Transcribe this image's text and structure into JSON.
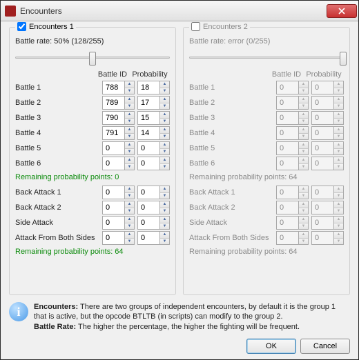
{
  "window": {
    "title": "Encounters"
  },
  "groups": [
    {
      "checked": true,
      "title": "Encounters 1",
      "rate_text": "Battle rate: 50% (128/255)",
      "slider_pos_pct": 50,
      "col_id": "Battle ID",
      "col_prob": "Probability",
      "battles": [
        {
          "label": "Battle 1",
          "id": "788",
          "prob": "18"
        },
        {
          "label": "Battle 2",
          "id": "789",
          "prob": "17"
        },
        {
          "label": "Battle 3",
          "id": "790",
          "prob": "15"
        },
        {
          "label": "Battle 4",
          "id": "791",
          "prob": "14"
        },
        {
          "label": "Battle 5",
          "id": "0",
          "prob": "0"
        },
        {
          "label": "Battle 6",
          "id": "0",
          "prob": "0"
        }
      ],
      "points1": "Remaining probability points: 0",
      "specials": [
        {
          "label": "Back Attack 1",
          "id": "0",
          "prob": "0"
        },
        {
          "label": "Back Attack 2",
          "id": "0",
          "prob": "0"
        },
        {
          "label": "Side Attack",
          "id": "0",
          "prob": "0"
        },
        {
          "label": "Attack From Both Sides",
          "id": "0",
          "prob": "0"
        }
      ],
      "points2": "Remaining probability points: 64"
    },
    {
      "checked": false,
      "title": "Encounters 2",
      "rate_text": "Battle rate: error (0/255)",
      "slider_pos_pct": 100,
      "col_id": "Battle ID",
      "col_prob": "Probability",
      "battles": [
        {
          "label": "Battle 1",
          "id": "0",
          "prob": "0"
        },
        {
          "label": "Battle 2",
          "id": "0",
          "prob": "0"
        },
        {
          "label": "Battle 3",
          "id": "0",
          "prob": "0"
        },
        {
          "label": "Battle 4",
          "id": "0",
          "prob": "0"
        },
        {
          "label": "Battle 5",
          "id": "0",
          "prob": "0"
        },
        {
          "label": "Battle 6",
          "id": "0",
          "prob": "0"
        }
      ],
      "points1": "Remaining probability points: 64",
      "specials": [
        {
          "label": "Back Attack 1",
          "id": "0",
          "prob": "0"
        },
        {
          "label": "Back Attack 2",
          "id": "0",
          "prob": "0"
        },
        {
          "label": "Side Attack",
          "id": "0",
          "prob": "0"
        },
        {
          "label": "Attack From Both Sides",
          "id": "0",
          "prob": "0"
        }
      ],
      "points2": "Remaining probability points: 64"
    }
  ],
  "info": {
    "label1": "Encounters:",
    "text1": " There are two groups of independent encounters, by default it is the group 1 that is active, but the opcode BTLTB (in scripts) can modify to the group 2.",
    "label2": "Battle Rate:",
    "text2": " The higher the percentage, the higher the fighting will be frequent."
  },
  "buttons": {
    "ok": "OK",
    "cancel": "Cancel"
  }
}
